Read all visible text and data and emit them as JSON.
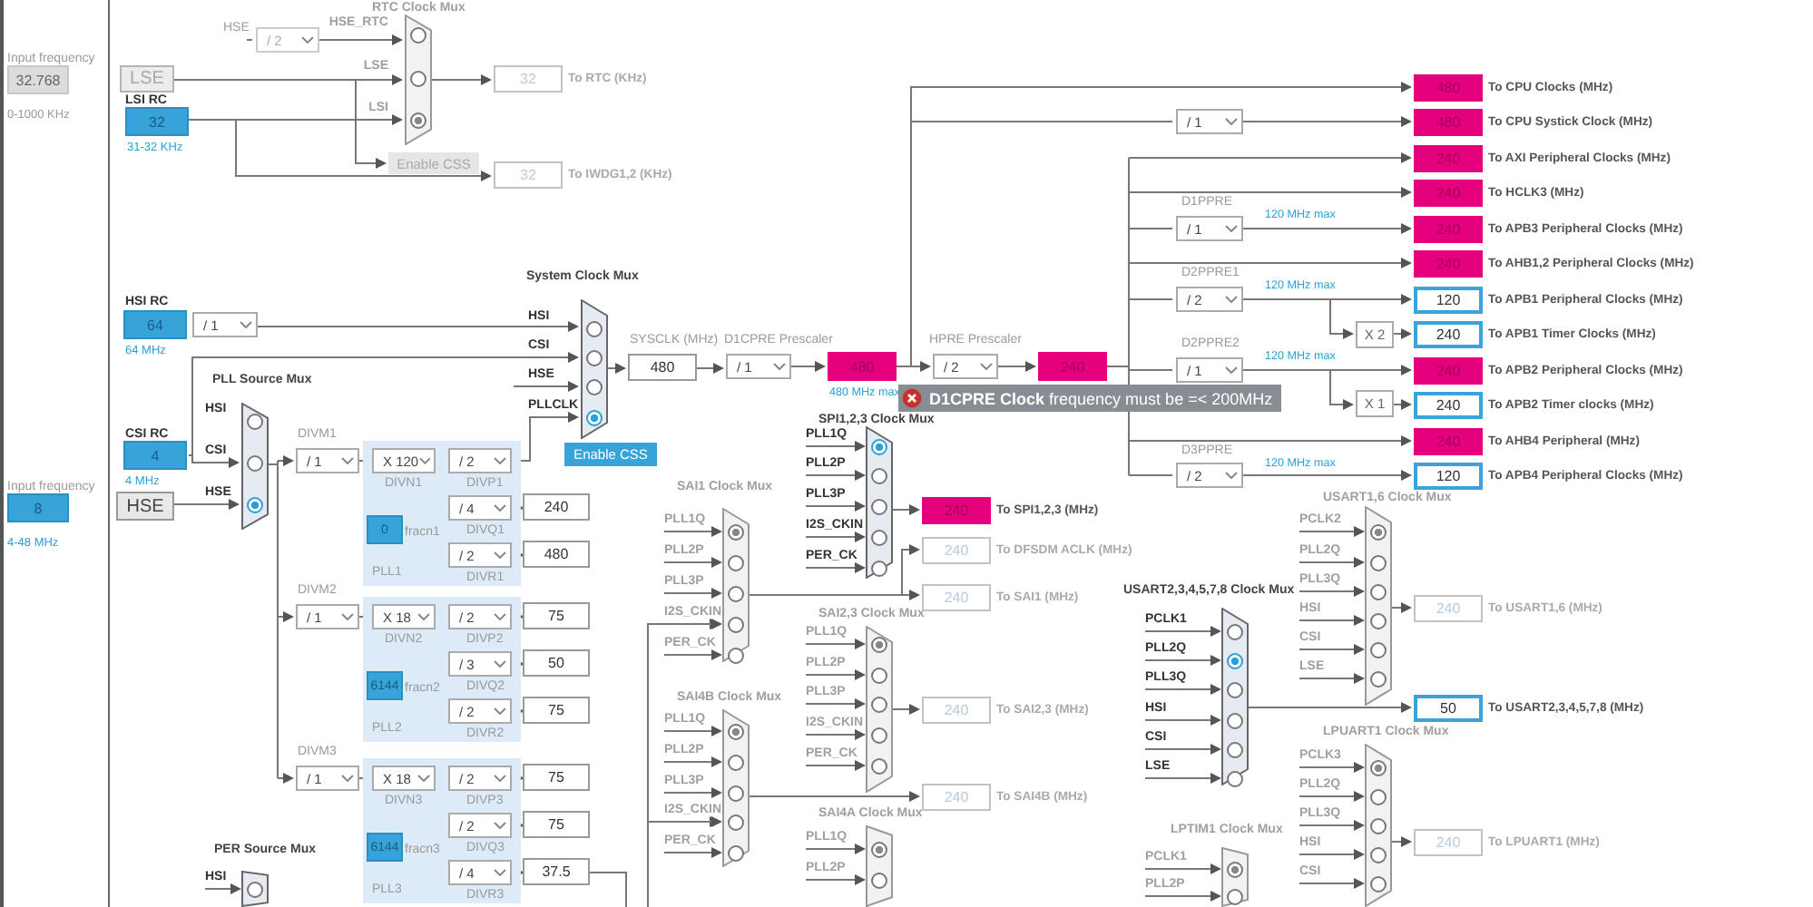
{
  "input_frequencies": [
    {
      "label": "Input frequency",
      "value": "32.768",
      "range": "0-1000 KHz",
      "enabled": false
    },
    {
      "label": "Input frequency",
      "value": "8",
      "range": "4-48 MHz",
      "enabled": true
    }
  ],
  "oscillators": [
    {
      "kind": "external",
      "name": "LSE",
      "enabled": false
    },
    {
      "kind": "rc",
      "name": "LSI RC",
      "value": "32",
      "range": "31-32 KHz"
    },
    {
      "kind": "rc",
      "name": "HSI RC",
      "value": "64",
      "range": "64 MHz"
    },
    {
      "kind": "rc",
      "name": "CSI RC",
      "value": "4",
      "range": "4 MHz"
    },
    {
      "kind": "external",
      "name": "HSE",
      "enabled": true
    }
  ],
  "signal_labels": [
    "HSE"
  ],
  "dropdowns": [
    {
      "value": "/ 2",
      "enabled": false
    },
    {
      "value": "/ 1",
      "enabled": true
    },
    {
      "label": "D1CPRE Prescaler",
      "value": "/ 1",
      "enabled": true
    },
    {
      "label": "HPRE Prescaler",
      "value": "/ 2",
      "enabled": true
    },
    {
      "value": "/ 1",
      "enabled": true
    },
    {
      "label": "D1PPRE",
      "value": "/ 1",
      "enabled": true
    },
    {
      "label": "D2PPRE1",
      "value": "/ 2",
      "enabled": true
    },
    {
      "label": "D2PPRE2",
      "value": "/ 1",
      "enabled": true
    },
    {
      "label": "D3PPRE",
      "value": "/ 2",
      "enabled": true
    }
  ],
  "muxes": [
    {
      "title": "RTC Clock Mux",
      "active": false,
      "inputs": [
        {
          "label": "HSE_RTC",
          "selected": false
        },
        {
          "label": "LSE",
          "selected": false
        },
        {
          "label": "LSI",
          "selected": true
        }
      ]
    },
    {
      "title": "System Clock Mux",
      "active": true,
      "inputs": [
        {
          "label": "HSI",
          "selected": false
        },
        {
          "label": "CSI",
          "selected": false
        },
        {
          "label": "HSE",
          "selected": false
        },
        {
          "label": "PLLCLK",
          "selected": true
        }
      ]
    },
    {
      "title": "PLL Source Mux",
      "active": true,
      "inputs": [
        {
          "label": "HSI",
          "selected": false
        },
        {
          "label": "CSI",
          "selected": false
        },
        {
          "label": "HSE",
          "selected": true
        }
      ]
    },
    {
      "title": "SPI1,2,3 Clock Mux",
      "active": true,
      "inputs": [
        {
          "label": "PLL1Q",
          "selected": true
        },
        {
          "label": "PLL2P",
          "selected": false
        },
        {
          "label": "PLL3P",
          "selected": false
        },
        {
          "label": "I2S_CKIN",
          "selected": false
        },
        {
          "label": "PER_CK",
          "selected": false
        }
      ]
    },
    {
      "title": "SAI1 Clock Mux",
      "active": false,
      "inputs": [
        {
          "label": "PLL1Q",
          "selected": true
        },
        {
          "label": "PLL2P",
          "selected": false
        },
        {
          "label": "PLL3P",
          "selected": false
        },
        {
          "label": "I2S_CKIN",
          "selected": false
        },
        {
          "label": "PER_CK",
          "selected": false
        }
      ]
    },
    {
      "title": "SAI2,3 Clock Mux",
      "active": false,
      "inputs": [
        {
          "label": "PLL1Q",
          "selected": true
        },
        {
          "label": "PLL2P",
          "selected": false
        },
        {
          "label": "PLL3P",
          "selected": false
        },
        {
          "label": "I2S_CKIN",
          "selected": false
        },
        {
          "label": "PER_CK",
          "selected": false
        }
      ]
    },
    {
      "title": "SAI4B Clock Mux",
      "active": false,
      "inputs": [
        {
          "label": "PLL1Q",
          "selected": true
        },
        {
          "label": "PLL2P",
          "selected": false
        },
        {
          "label": "PLL3P",
          "selected": false
        },
        {
          "label": "I2S_CKIN",
          "selected": false
        },
        {
          "label": "PER_CK",
          "selected": false
        }
      ]
    },
    {
      "title": "SAI4A Clock Mux",
      "active": false,
      "inputs": [
        {
          "label": "PLL1Q",
          "selected": true
        },
        {
          "label": "PLL2P",
          "selected": false
        }
      ]
    },
    {
      "title": "USART2,3,4,5,7,8 Clock Mux",
      "active": true,
      "inputs": [
        {
          "label": "PCLK1",
          "selected": false
        },
        {
          "label": "PLL2Q",
          "selected": true
        },
        {
          "label": "PLL3Q",
          "selected": false
        },
        {
          "label": "HSI",
          "selected": false
        },
        {
          "label": "CSI",
          "selected": false
        },
        {
          "label": "LSE",
          "selected": false
        }
      ]
    },
    {
      "title": "USART1,6 Clock Mux",
      "active": false,
      "inputs": [
        {
          "label": "PCLK2",
          "selected": true
        },
        {
          "label": "PLL2Q",
          "selected": false
        },
        {
          "label": "PLL3Q",
          "selected": false
        },
        {
          "label": "HSI",
          "selected": false
        },
        {
          "label": "CSI",
          "selected": false
        },
        {
          "label": "LSE",
          "selected": false
        }
      ]
    },
    {
      "title": "LPUART1 Clock Mux",
      "active": false,
      "inputs": [
        {
          "label": "PCLK3",
          "selected": true
        },
        {
          "label": "PLL2Q",
          "selected": false
        },
        {
          "label": "PLL3Q",
          "selected": false
        },
        {
          "label": "HSI",
          "selected": false
        },
        {
          "label": "CSI",
          "selected": false
        }
      ]
    },
    {
      "title": "LPTIM1 Clock Mux",
      "active": false,
      "inputs": [
        {
          "label": "PCLK1",
          "selected": true
        },
        {
          "label": "PLL2P",
          "selected": false
        }
      ]
    },
    {
      "title": "PER Source Mux",
      "active": true,
      "inputs": [
        {
          "label": "HSI",
          "selected": false
        }
      ]
    }
  ],
  "sysclk": {
    "label": "SYSCLK (MHz)",
    "value": "480"
  },
  "bus_clocks": [
    {
      "value": "480",
      "kind": "error",
      "note": "480 MHz max"
    },
    {
      "value": "240",
      "kind": "error"
    }
  ],
  "tooltip": {
    "text": "**D1CPRE Clock** frequency must be =< 200MHz"
  },
  "limit_notes": [
    "120 MHz max",
    "120 MHz max",
    "120 MHz max",
    "120 MHz max"
  ],
  "multipliers": [
    "X 2",
    "X 1"
  ],
  "buttons": [
    {
      "label": "Enable CSS",
      "enabled": false
    },
    {
      "label": "Enable CSS",
      "enabled": true
    }
  ],
  "plls": [
    {
      "name": "PLL1",
      "divm_label": "DIVM1",
      "divm": "/ 1",
      "divn_label": "DIVN1",
      "divn": "X 120",
      "fracn_label": "fracn1",
      "fracn": "0",
      "dividers": [
        {
          "label": "DIVP1",
          "value": "/ 2"
        },
        {
          "label": "DIVQ1",
          "value": "/ 4",
          "output": "240"
        },
        {
          "label": "DIVR1",
          "value": "/ 2",
          "output": "480"
        }
      ]
    },
    {
      "name": "PLL2",
      "divm_label": "DIVM2",
      "divm": "/ 1",
      "divn_label": "DIVN2",
      "divn": "X 18",
      "fracn_label": "fracn2",
      "fracn": "6144",
      "dividers": [
        {
          "label": "DIVP2",
          "value": "/ 2",
          "output": "75"
        },
        {
          "label": "DIVQ2",
          "value": "/ 3",
          "output": "50"
        },
        {
          "label": "DIVR2",
          "value": "/ 2",
          "output": "75"
        }
      ]
    },
    {
      "name": "PLL3",
      "divm_label": "DIVM3",
      "divm": "/ 1",
      "divn_label": "DIVN3",
      "divn": "X 18",
      "fracn_label": "fracn3",
      "fracn": "6144",
      "dividers": [
        {
          "label": "DIVP3",
          "value": "/ 2",
          "output": "75"
        },
        {
          "label": "DIVQ3",
          "value": "/ 2",
          "output": "75"
        },
        {
          "label": "DIVR3",
          "value": "/ 4",
          "output": "37.5"
        }
      ]
    }
  ],
  "outputs": [
    {
      "value": "32",
      "label": "To RTC (KHz)",
      "kind": "inactive"
    },
    {
      "value": "32",
      "label": "To IWDG1,2 (KHz)",
      "kind": "inactive"
    },
    {
      "value": "480",
      "label": "To CPU Clocks (MHz)",
      "kind": "error"
    },
    {
      "value": "480",
      "label": "To CPU Systick Clock (MHz)",
      "kind": "error"
    },
    {
      "value": "240",
      "label": "To AXI Peripheral Clocks (MHz)",
      "kind": "error"
    },
    {
      "value": "240",
      "label": "To HCLK3 (MHz)",
      "kind": "error"
    },
    {
      "value": "240",
      "label": "To APB3 Peripheral Clocks (MHz)",
      "kind": "error"
    },
    {
      "value": "240",
      "label": "To AHB1,2 Peripheral Clocks (MHz)",
      "kind": "error"
    },
    {
      "value": "120",
      "label": "To APB1 Peripheral Clocks (MHz)",
      "kind": "valid"
    },
    {
      "value": "240",
      "label": "To APB1 Timer Clocks (MHz)",
      "kind": "valid"
    },
    {
      "value": "240",
      "label": "To APB2 Peripheral Clocks (MHz)",
      "kind": "error"
    },
    {
      "value": "240",
      "label": "To APB2 Timer clocks (MHz)",
      "kind": "valid"
    },
    {
      "value": "240",
      "label": "To AHB4 Peripheral (MHz)",
      "kind": "error"
    },
    {
      "value": "120",
      "label": "To APB4 Peripheral Clocks (MHz)",
      "kind": "valid"
    },
    {
      "value": "240",
      "label": "To SPI1,2,3 (MHz)",
      "kind": "error"
    },
    {
      "value": "240",
      "label": "To DFSDM ACLK (MHz)",
      "kind": "inactive"
    },
    {
      "value": "240",
      "label": "To SAI1 (MHz)",
      "kind": "inactive"
    },
    {
      "value": "240",
      "label": "To SAI2,3 (MHz)",
      "kind": "inactive"
    },
    {
      "value": "240",
      "label": "To SAI4B (MHz)",
      "kind": "inactive"
    },
    {
      "value": "240",
      "label": "To USART1,6 (MHz)",
      "kind": "inactive"
    },
    {
      "value": "50",
      "label": "To USART2,3,4,5,7,8 (MHz)",
      "kind": "valid"
    },
    {
      "value": "240",
      "label": "To LPUART1 (MHz)",
      "kind": "inactive"
    }
  ]
}
